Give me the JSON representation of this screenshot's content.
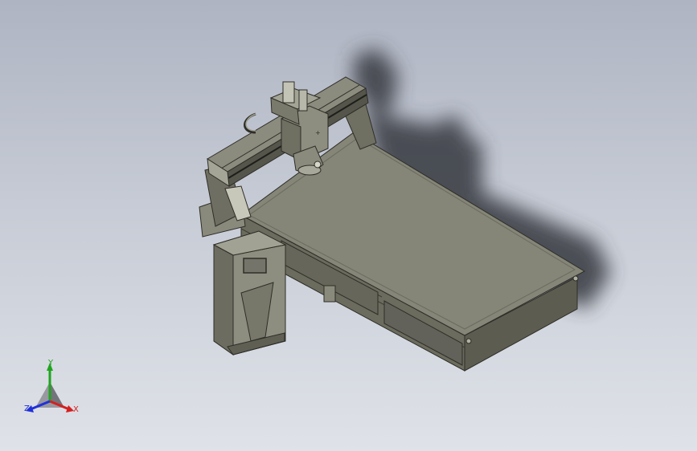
{
  "triad": {
    "x_label": "X",
    "y_label": "Y",
    "z_label": "Z",
    "x_color": "#d42020",
    "y_color": "#1fa51f",
    "z_color": "#2030d8"
  },
  "colors": {
    "body": "#7a7a6c",
    "body_dark": "#4e4e44",
    "body_light": "#9c9c8e",
    "shadow": "#3c3f47"
  }
}
